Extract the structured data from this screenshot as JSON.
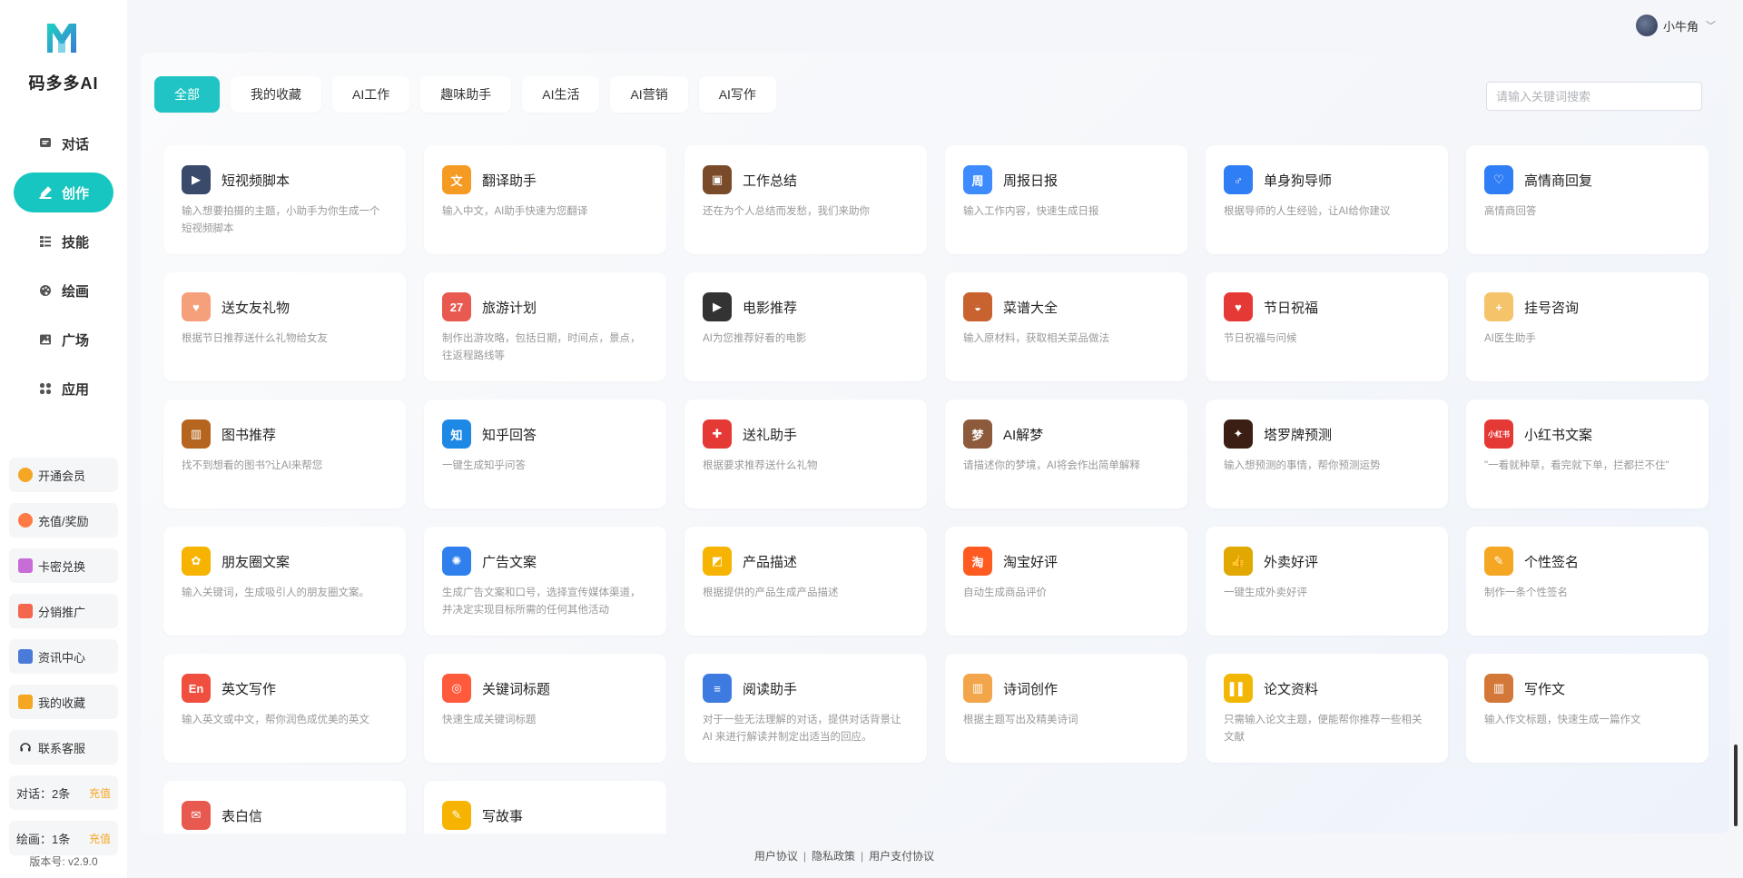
{
  "brand": {
    "name": "码多多AI",
    "color": "#17c6c0"
  },
  "nav": [
    {
      "label": "对话",
      "icon": "chat-icon",
      "active": false
    },
    {
      "label": "创作",
      "icon": "pen-icon",
      "active": true
    },
    {
      "label": "技能",
      "icon": "list-icon",
      "active": false
    },
    {
      "label": "绘画",
      "icon": "palette-icon",
      "active": false
    },
    {
      "label": "广场",
      "icon": "image-icon",
      "active": false
    },
    {
      "label": "应用",
      "icon": "apps-icon",
      "active": false
    }
  ],
  "side_links": [
    {
      "label": "开通会员",
      "icon": "vip-icon",
      "color": "#f5a623"
    },
    {
      "label": "充值/奖励",
      "icon": "coin-icon",
      "color": "#ff7a45"
    },
    {
      "label": "卡密兑换",
      "icon": "card-icon",
      "color": "#c86dd7"
    },
    {
      "label": "分销推广",
      "icon": "share-icon",
      "color": "#f5664e"
    },
    {
      "label": "资讯中心",
      "icon": "news-icon",
      "color": "#4a7bd8"
    },
    {
      "label": "我的收藏",
      "icon": "star-icon",
      "color": "#f5a623"
    },
    {
      "label": "联系客服",
      "icon": "headset-icon",
      "color": "#333333"
    }
  ],
  "quota": [
    {
      "label": "对话：2条",
      "action": "充值"
    },
    {
      "label": "绘画：1条",
      "action": "充值"
    }
  ],
  "version": "版本号: v2.9.0",
  "user": {
    "name": "小牛角"
  },
  "tabs": [
    {
      "label": "全部",
      "active": true
    },
    {
      "label": "我的收藏",
      "active": false
    },
    {
      "label": "AI工作",
      "active": false
    },
    {
      "label": "趣味助手",
      "active": false
    },
    {
      "label": "AI生活",
      "active": false
    },
    {
      "label": "AI营销",
      "active": false
    },
    {
      "label": "AI写作",
      "active": false
    }
  ],
  "search": {
    "placeholder": "请输入关键词搜索",
    "value": ""
  },
  "cards": [
    {
      "title": "短视频脚本",
      "desc": "输入想要拍摄的主题，小助手为你生成一个短视频脚本",
      "icon": "clapperboard-icon",
      "color": "#3a4a6b",
      "glyph": "▶"
    },
    {
      "title": "翻译助手",
      "desc": "输入中文，AI助手快速为您翻译",
      "icon": "translate-icon",
      "color": "#f59a23",
      "glyph": "文"
    },
    {
      "title": "工作总结",
      "desc": "还在为个人总结而发愁，我们来助你",
      "icon": "briefcase-icon",
      "color": "#7a4b2a",
      "glyph": "▣"
    },
    {
      "title": "周报日报",
      "desc": "输入工作内容，快速生成日报",
      "icon": "report-icon",
      "color": "#3d8bfd",
      "glyph": "周"
    },
    {
      "title": "单身狗导师",
      "desc": "根据导师的人生经验，让AI给你建议",
      "icon": "mentor-icon",
      "color": "#2f7ef5",
      "glyph": "♂"
    },
    {
      "title": "高情商回复",
      "desc": "高情商回答",
      "icon": "heart-chat-icon",
      "color": "#2f7ef5",
      "glyph": "♡"
    },
    {
      "title": "送女友礼物",
      "desc": "根据节日推荐送什么礼物给女友",
      "icon": "couple-icon",
      "color": "#f5a07a",
      "glyph": "♥"
    },
    {
      "title": "旅游计划",
      "desc": "制作出游攻略，包括日期，时间点，景点，往返程路线等",
      "icon": "calendar-icon",
      "color": "#e85a4f",
      "glyph": "27"
    },
    {
      "title": "电影推荐",
      "desc": "AI为您推荐好看的电影",
      "icon": "film-icon",
      "color": "#333333",
      "glyph": "▶"
    },
    {
      "title": "菜谱大全",
      "desc": "输入原材料，获取相关菜品做法",
      "icon": "bowl-icon",
      "color": "#c8622e",
      "glyph": "◒"
    },
    {
      "title": "节日祝福",
      "desc": "节日祝福与问候",
      "icon": "heart-icon",
      "color": "#e53935",
      "glyph": "♥"
    },
    {
      "title": "挂号咨询",
      "desc": "AI医生助手",
      "icon": "doctor-icon",
      "color": "#f5c36a",
      "glyph": "+"
    },
    {
      "title": "图书推荐",
      "desc": "找不到想看的图书?让AI来帮您",
      "icon": "book-icon",
      "color": "#b5651d",
      "glyph": "▥"
    },
    {
      "title": "知乎回答",
      "desc": "一键生成知乎问答",
      "icon": "zhihu-icon",
      "color": "#1e88e5",
      "glyph": "知"
    },
    {
      "title": "送礼助手",
      "desc": "根据要求推荐送什么礼物",
      "icon": "gift-icon",
      "color": "#e53935",
      "glyph": "✚"
    },
    {
      "title": "AI解梦",
      "desc": "请描述你的梦境，AI将会作出简单解释",
      "icon": "dream-icon",
      "color": "#8d5a3b",
      "glyph": "梦"
    },
    {
      "title": "塔罗牌预测",
      "desc": "输入想预测的事情，帮你预测运势",
      "icon": "tarot-icon",
      "color": "#3b1f14",
      "glyph": "✦"
    },
    {
      "title": "小红书文案",
      "desc": "\"一看就种草，看完就下单，拦都拦不住\"",
      "icon": "xiaohongshu-icon",
      "color": "#e53935",
      "glyph": "小红书"
    },
    {
      "title": "朋友圈文案",
      "desc": "输入关键词，生成吸引人的朋友圈文案。",
      "icon": "moments-icon",
      "color": "#f6b400",
      "glyph": "✿"
    },
    {
      "title": "广告文案",
      "desc": "生成广告文案和口号，选择宣传媒体渠道，并决定实现目标所需的任何其他活动",
      "icon": "lightbulb-icon",
      "color": "#2f80ed",
      "glyph": "✺"
    },
    {
      "title": "产品描述",
      "desc": "根据提供的产品生成产品描述",
      "icon": "shopping-bag-icon",
      "color": "#f6b400",
      "glyph": "◩"
    },
    {
      "title": "淘宝好评",
      "desc": "自动生成商品评价",
      "icon": "taobao-icon",
      "color": "#ff5a1f",
      "glyph": "淘"
    },
    {
      "title": "外卖好评",
      "desc": "一键生成外卖好评",
      "icon": "thumbs-up-icon",
      "color": "#e0a800",
      "glyph": "👍"
    },
    {
      "title": "个性签名",
      "desc": "制作一条个性签名",
      "icon": "pencil-icon",
      "color": "#f5a623",
      "glyph": "✎"
    },
    {
      "title": "英文写作",
      "desc": "输入英文或中文，帮你润色成优美的英文",
      "icon": "english-icon",
      "color": "#f04e3e",
      "glyph": "En"
    },
    {
      "title": "关键词标题",
      "desc": "快速生成关键词标题",
      "icon": "target-icon",
      "color": "#ff5a3c",
      "glyph": "◎"
    },
    {
      "title": "阅读助手",
      "desc": "对于一些无法理解的对话，提供对话背景让 AI 来进行解读并制定出适当的回应。",
      "icon": "books-icon",
      "color": "#3d7be0",
      "glyph": "≡"
    },
    {
      "title": "诗词创作",
      "desc": "根据主题写出及精美诗词",
      "icon": "open-book-icon",
      "color": "#f2a54a",
      "glyph": "▥"
    },
    {
      "title": "论文资料",
      "desc": "只需输入论文主题，便能帮你推荐一些相关文献",
      "icon": "binders-icon",
      "color": "#f2b705",
      "glyph": "▌▌"
    },
    {
      "title": "写作文",
      "desc": "输入作文标题，快速生成一篇作文",
      "icon": "notebook-icon",
      "color": "#d4783a",
      "glyph": "▥"
    },
    {
      "title": "表白信",
      "desc": "",
      "icon": "envelope-icon",
      "color": "#e85a4f",
      "glyph": "✉"
    },
    {
      "title": "写故事",
      "desc": "",
      "icon": "story-icon",
      "color": "#f6b400",
      "glyph": "✎"
    }
  ],
  "footer": {
    "links": [
      "用户协议",
      "隐私政策",
      "用户支付协议"
    ],
    "separator": "|"
  }
}
